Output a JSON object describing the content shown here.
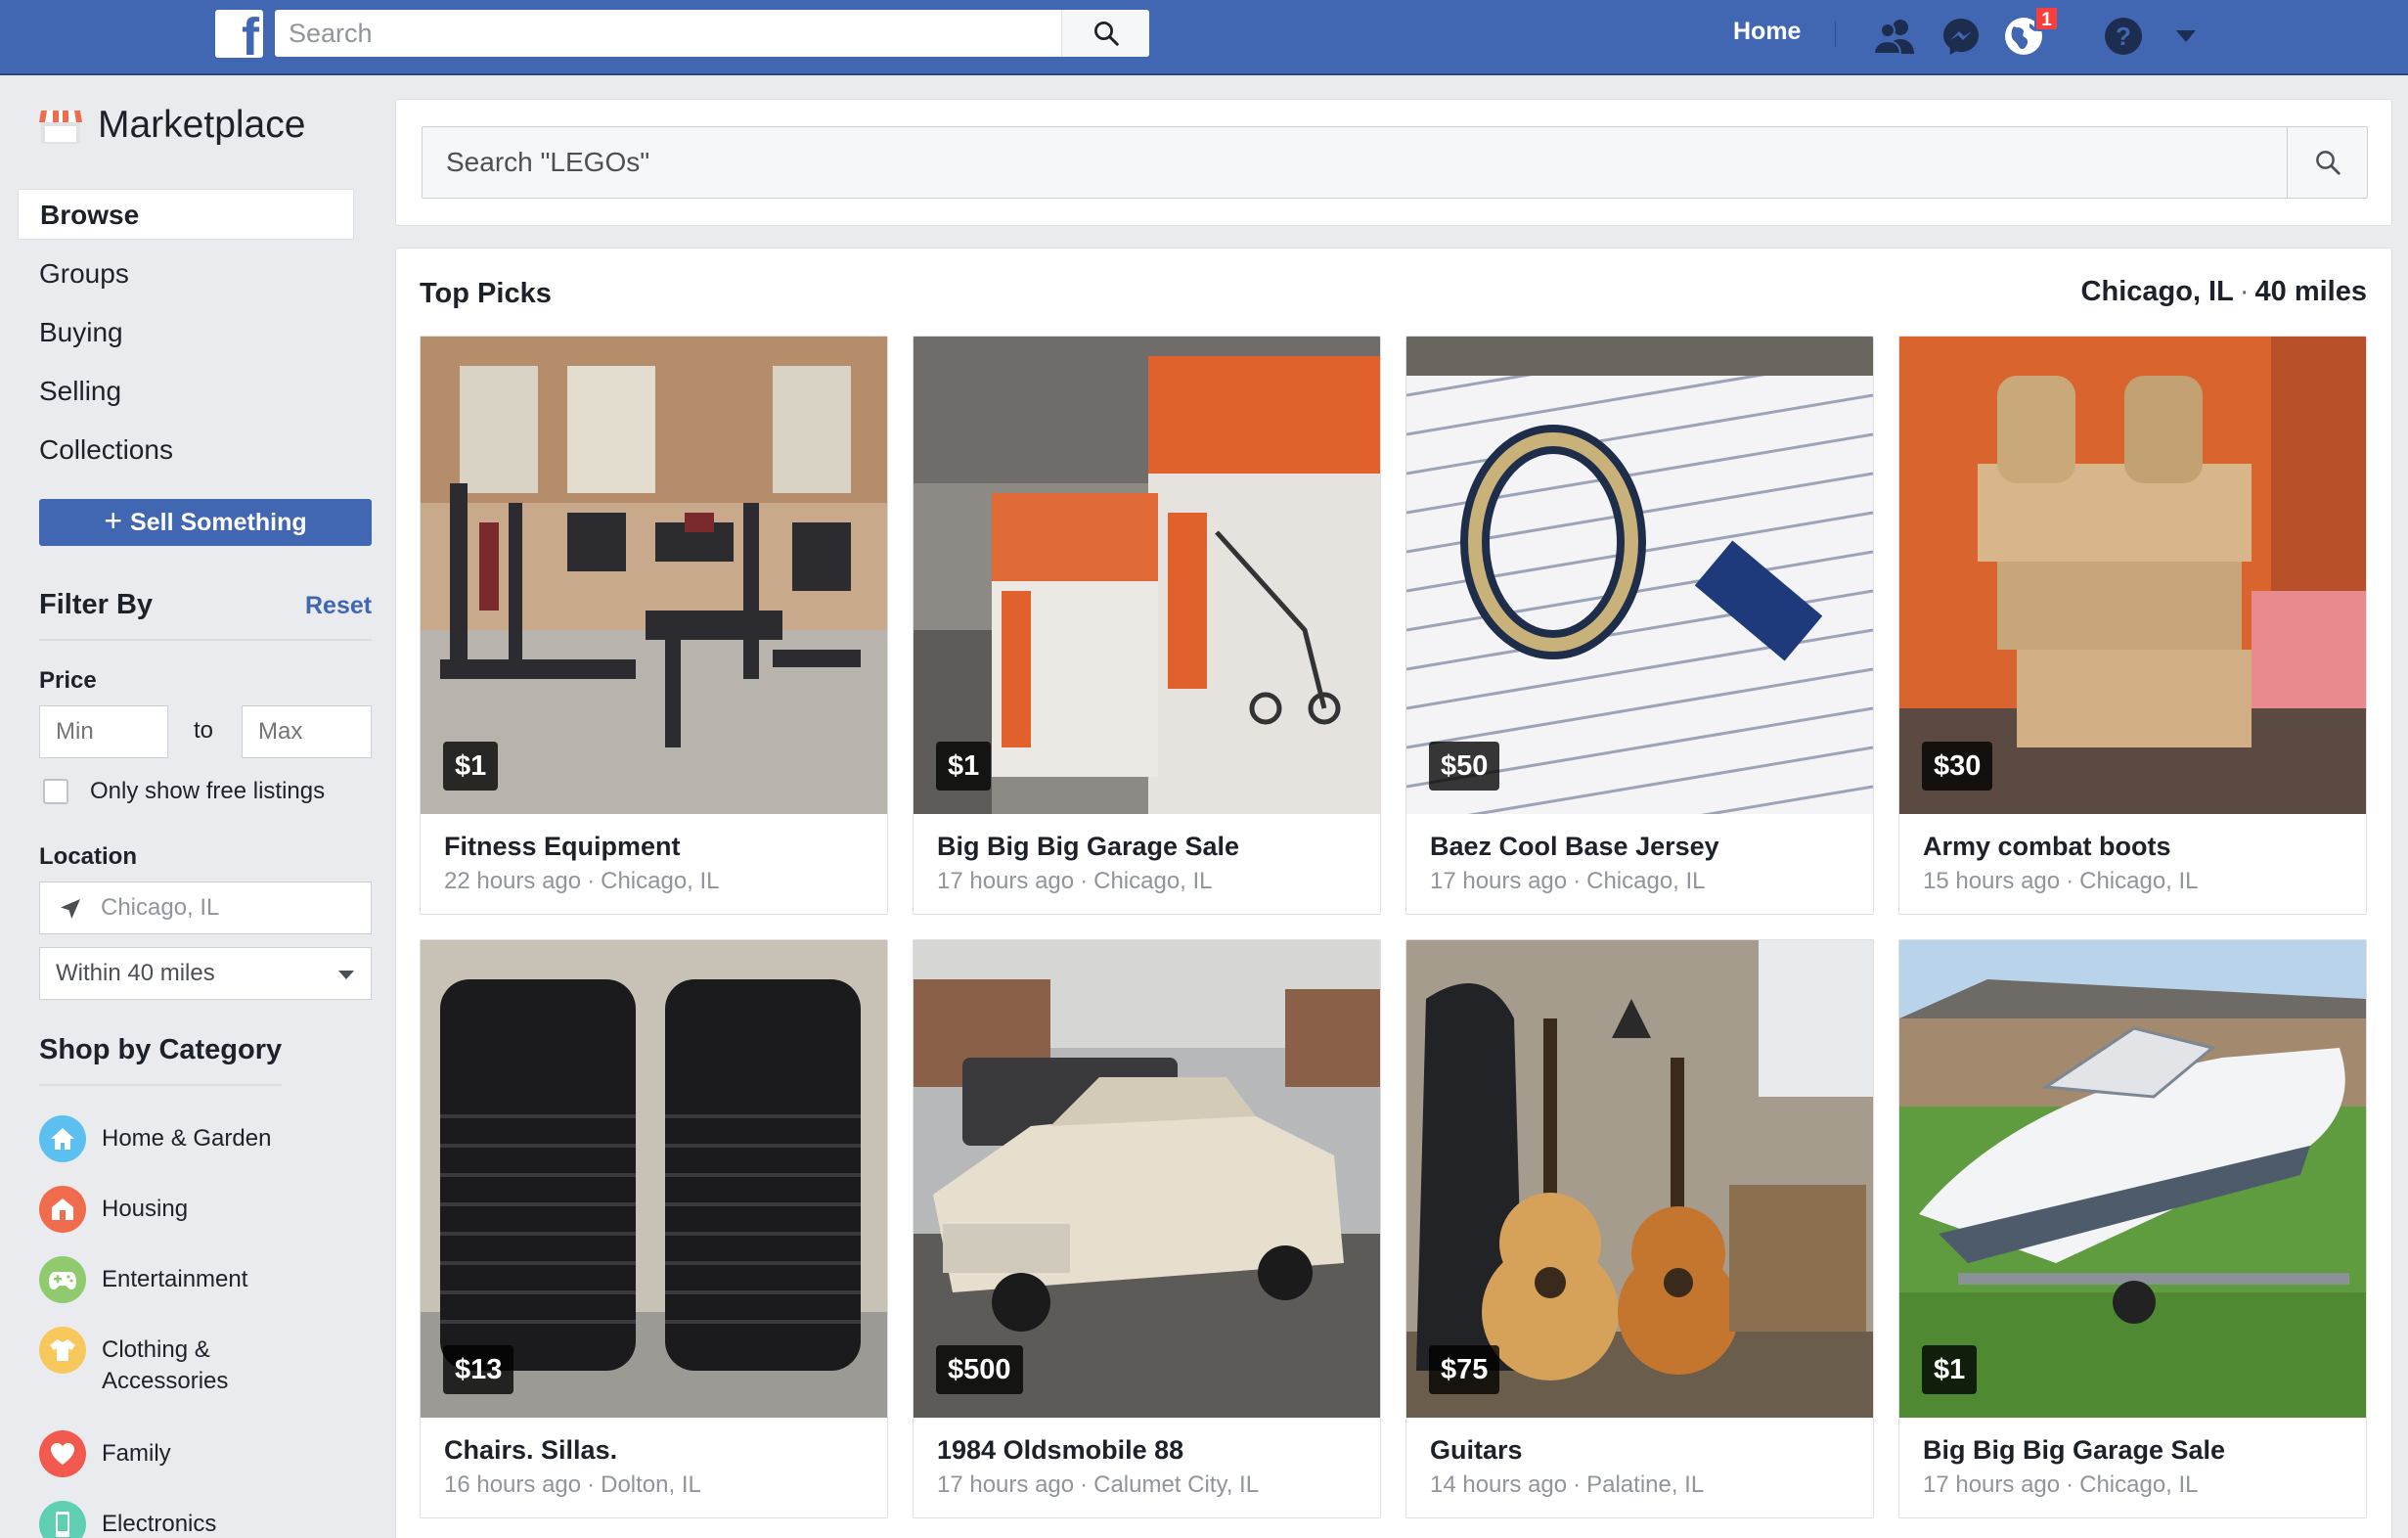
{
  "topbar": {
    "logo": "f",
    "search_placeholder": "Search",
    "home_label": "Home",
    "notification_count": "1",
    "icons": [
      "friend-requests-icon",
      "messenger-icon",
      "globe-notifications-icon",
      "help-icon",
      "caret-down-icon"
    ]
  },
  "sidebar": {
    "title": "Marketplace",
    "nav": [
      {
        "label": "Browse",
        "active": true
      },
      {
        "label": "Groups"
      },
      {
        "label": "Buying"
      },
      {
        "label": "Selling"
      },
      {
        "label": "Collections"
      }
    ],
    "sell_label": "Sell Something",
    "filter_title": "Filter By",
    "reset_label": "Reset",
    "price_label": "Price",
    "min_placeholder": "Min",
    "to_label": "to",
    "max_placeholder": "Max",
    "free_label": "Only show free listings",
    "location_label": "Location",
    "location_placeholder": "Chicago, IL",
    "radius_value": "Within 40 miles",
    "category_title": "Shop by Category",
    "categories": [
      {
        "label": "Home & Garden",
        "color": "#5bc0f0",
        "icon": "home-icon"
      },
      {
        "label": "Housing",
        "color": "#f06c4d",
        "icon": "house-icon"
      },
      {
        "label": "Entertainment",
        "color": "#8fcb6e",
        "icon": "gamepad-icon"
      },
      {
        "label": "Clothing &\nAccessories",
        "color": "#f7c95c",
        "icon": "shirt-icon"
      },
      {
        "label": "Family",
        "color": "#f25a4f",
        "icon": "heart-icon"
      },
      {
        "label": "Electronics",
        "color": "#5fcfb4",
        "icon": "phone-icon"
      }
    ]
  },
  "main": {
    "search_placeholder": "Search \"LEGOs\"",
    "section_title": "Top Picks",
    "location": "Chicago, IL",
    "distance": "40 miles",
    "listings": [
      {
        "price": "$1",
        "title": "Fitness Equipment",
        "time": "22 hours ago",
        "place": "Chicago, IL"
      },
      {
        "price": "$1",
        "title": "Big Big Big Garage Sale",
        "time": "17 hours ago",
        "place": "Chicago, IL"
      },
      {
        "price": "$50",
        "title": "Baez Cool Base Jersey",
        "time": "17 hours ago",
        "place": "Chicago, IL"
      },
      {
        "price": "$30",
        "title": "Army combat boots",
        "time": "15 hours ago",
        "place": "Chicago, IL"
      },
      {
        "price": "$13",
        "title": "Chairs. Sillas.",
        "time": "16 hours ago",
        "place": "Dolton, IL"
      },
      {
        "price": "$500",
        "title": "1984 Oldsmobile 88",
        "time": "17 hours ago",
        "place": "Calumet City, IL"
      },
      {
        "price": "$75",
        "title": "Guitars",
        "time": "14 hours ago",
        "place": "Palatine, IL"
      },
      {
        "price": "$1",
        "title": "Big Big Big Garage Sale",
        "time": "17 hours ago",
        "place": "Chicago, IL"
      }
    ]
  },
  "colors": {
    "brand": "#4267b2",
    "page_bg": "#e9ebee",
    "link": "#4267b2",
    "badge": "#fa3e3e"
  }
}
